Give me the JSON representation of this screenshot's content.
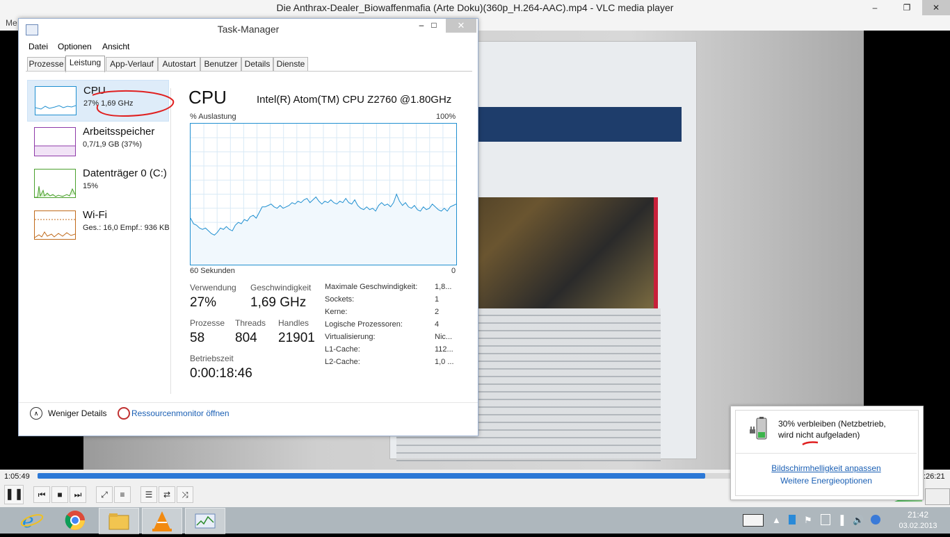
{
  "vlc": {
    "title": "Die Anthrax-Dealer_Biowaffenmafia (Arte Doku)(360p_H.264-AAC).mp4 - VLC media player",
    "menu_partial": "Me",
    "time_elapsed": "1:05:49",
    "time_total": ":26:21",
    "progress_fraction": 0.92,
    "window_controls": {
      "minimize": "–",
      "maximize": "❐",
      "close": "✕"
    },
    "controls": {
      "pause": "❚❚",
      "prev": "⏮",
      "stop": "■",
      "next": "⏭",
      "fullscreen": "⤢",
      "extended": "≡",
      "playlist": "☰",
      "loop": "⇄",
      "shuffle": "⤨"
    }
  },
  "taskmanager": {
    "title": "Task-Manager",
    "window_controls": {
      "minimize": "–",
      "maximize": "□",
      "close": "✕"
    },
    "menu": [
      "Datei",
      "Optionen",
      "Ansicht"
    ],
    "tabs": [
      "Prozesse",
      "Leistung",
      "App-Verlauf",
      "Autostart",
      "Benutzer",
      "Details",
      "Dienste"
    ],
    "active_tab": "Leistung",
    "sidebar": [
      {
        "title": "CPU",
        "sub": "27%  1,69 GHz",
        "color": "#1f8fd0"
      },
      {
        "title": "Arbeitsspeicher",
        "sub": "0,7/1,9 GB (37%)",
        "color": "#8e3aa8"
      },
      {
        "title": "Datenträger 0 (C:)",
        "sub": "15%",
        "color": "#4aa02c"
      },
      {
        "title": "Wi-Fi",
        "sub": "Ges.: 16,0  Empf.: 936 KB",
        "color": "#c06a1a"
      }
    ],
    "cpu": {
      "heading": "CPU",
      "model": "Intel(R) Atom(TM) CPU Z2760 @1.80GHz",
      "graph_label": "% Auslastung",
      "graph_max": "100%",
      "graph_time_start": "60 Sekunden",
      "graph_time_end": "0",
      "usage_history": [
        33,
        29,
        28,
        26,
        25,
        26,
        24,
        22,
        21,
        23,
        26,
        25,
        27,
        25,
        24,
        28,
        30,
        29,
        32,
        31,
        34,
        35,
        33,
        37,
        41,
        41,
        42,
        43,
        41,
        40,
        42,
        40,
        41,
        42,
        44,
        43,
        45,
        44,
        46,
        47,
        44,
        46,
        48,
        45,
        43,
        45,
        44,
        46,
        44,
        43,
        45,
        44,
        47,
        44,
        43,
        46,
        42,
        40,
        39,
        41,
        39,
        40,
        38,
        42,
        44,
        42,
        43,
        41,
        44,
        50,
        45,
        42,
        44,
        41,
        40,
        42,
        39,
        38,
        41,
        39,
        40,
        43,
        41,
        39,
        38,
        40,
        38,
        41,
        42,
        43
      ],
      "stats": {
        "verwendung_label": "Verwendung",
        "verwendung": "27%",
        "geschwindigkeit_label": "Geschwindigkeit",
        "geschwindigkeit": "1,69 GHz",
        "prozesse_label": "Prozesse",
        "prozesse": "58",
        "threads_label": "Threads",
        "threads": "804",
        "handles_label": "Handles",
        "handles": "21901",
        "betriebszeit_label": "Betriebszeit",
        "betriebszeit": "0:00:18:46"
      },
      "details": [
        {
          "key": "Maximale Geschwindigkeit:",
          "value": "1,8..."
        },
        {
          "key": "Sockets:",
          "value": "1"
        },
        {
          "key": "Kerne:",
          "value": "2"
        },
        {
          "key": "Logische Prozessoren:",
          "value": "4"
        },
        {
          "key": "Virtualisierung:",
          "value": "Nic..."
        },
        {
          "key": "L1-Cache:",
          "value": "112..."
        },
        {
          "key": "L2-Cache:",
          "value": "1,0 ..."
        }
      ]
    },
    "footer": {
      "less_icon": "∧",
      "less_details": "Weniger Details",
      "resource_monitor": "Ressourcenmonitor öffnen"
    }
  },
  "battery_popup": {
    "line1": "30% verbleiben (Netzbetrieb,",
    "line2": "wird nicht aufgeladen)",
    "link1": "Bildschirmhelligkeit anpassen",
    "link2": "Weitere Energieoptionen"
  },
  "taskbar": {
    "apps": [
      "internet-explorer",
      "chrome",
      "file-explorer",
      "vlc",
      "task-manager"
    ],
    "tray": {
      "arrow": "▲",
      "flag": "⚑",
      "signal": "▐",
      "volume": "🔊"
    },
    "time": "21:42",
    "date": "03.02.2013"
  }
}
